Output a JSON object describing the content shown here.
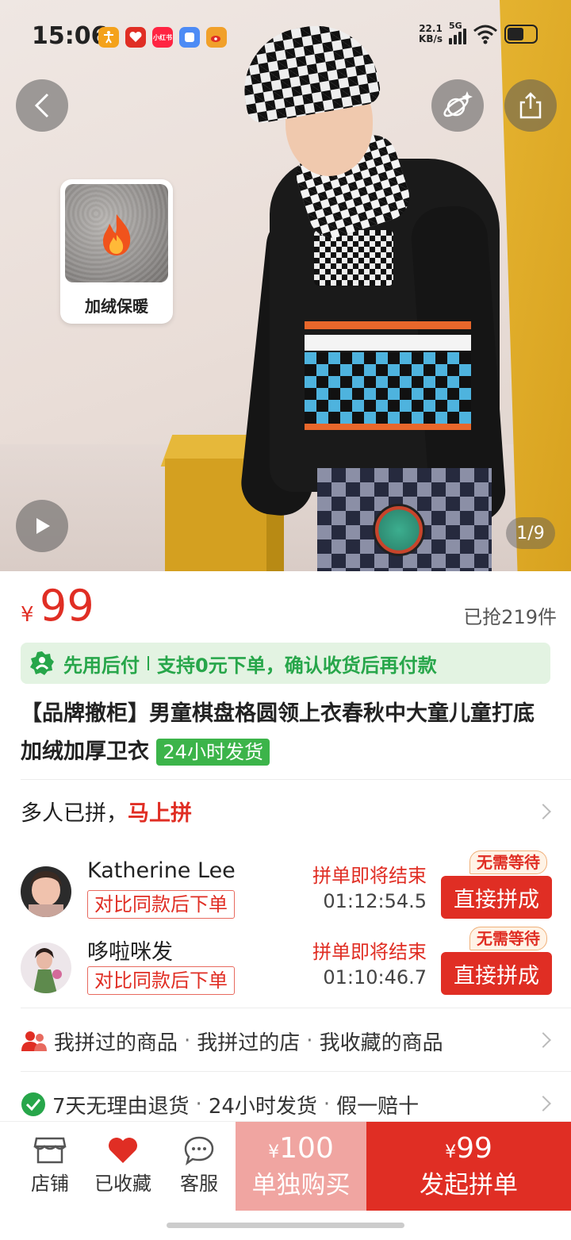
{
  "status_bar": {
    "time": "15:06",
    "net_speed_value": "22.1",
    "net_speed_unit": "KB/s",
    "network": "5G",
    "app_icons": [
      {
        "name": "accessibility",
        "color": "#f4a21b",
        "glyph": "†"
      },
      {
        "name": "heart-app",
        "color": "#e02e24",
        "glyph": "♥"
      },
      {
        "name": "xiaohongshu",
        "color": "#ff2442",
        "glyph": "小红书"
      },
      {
        "name": "blue-app",
        "color": "#4d8bf5",
        "glyph": "□"
      },
      {
        "name": "weibo",
        "color": "#f1a02a",
        "glyph": "●"
      }
    ]
  },
  "hero": {
    "page_indicator": "1/9",
    "feature_badge": "加绒保暖"
  },
  "product": {
    "currency": "¥",
    "price": "99",
    "sold": "已抢219件",
    "pay_later": "先用后付",
    "pay_note": "支持0元下单，确认收货后再付款",
    "title": "【品牌撤柜】男童棋盘格圆领上衣春秋中大童儿童打底加绒加厚卫衣",
    "ship_tag": "24小时发货"
  },
  "group_buy": {
    "lead": "多人已拼，",
    "highlight": "马上拼",
    "rows": [
      {
        "name": "Katherine Lee",
        "compare": "对比同款后下单",
        "ending": "拼单即将结束",
        "countdown": "01:12:54.5",
        "no_wait": "无需等待",
        "join": "直接拼成",
        "avatar_color": "#c9a49a"
      },
      {
        "name": "哆啦咪发",
        "compare": "对比同款后下单",
        "ending": "拼单即将结束",
        "countdown": "01:10:46.7",
        "no_wait": "无需等待",
        "join": "直接拼成",
        "avatar_color": "#5e8a4d"
      }
    ]
  },
  "links": {
    "items": [
      "我拼过的商品",
      "我拼过的店",
      "我收藏的商品"
    ],
    "separator": "·"
  },
  "guarantees": {
    "items": [
      "7天无理由退货",
      "24小时发货",
      "假一赔十"
    ],
    "separator": "·"
  },
  "bottom_bar": {
    "store": "店铺",
    "favorited": "已收藏",
    "service": "客服",
    "alone_price": "100",
    "alone_label": "单独购买",
    "group_price": "99",
    "group_label": "发起拼单"
  },
  "colors": {
    "accent": "#e02e24",
    "green": "#27a64a"
  }
}
